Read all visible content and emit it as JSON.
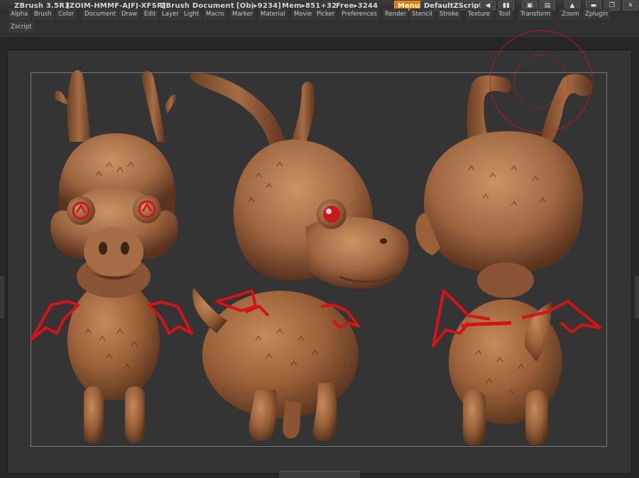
{
  "titlebar": {
    "app": "ZBrush 3.5R3",
    "serial": "[ZOIM-HMMF-AJFJ-XFSR]",
    "document": "ZBrush Document",
    "obj": "[Obj▸9234]",
    "mem": "Mem▸851+32",
    "free": "Free▸3244",
    "menus_label": "Menus",
    "script_label": "DefaultZScript"
  },
  "menubar": {
    "items": [
      "Alpha",
      "Brush",
      "Color",
      "Document",
      "Draw",
      "Edit",
      "Layer",
      "Light",
      "Macro",
      "Marker",
      "Material",
      "Movie",
      "Picker",
      "Preferences",
      "Render",
      "Stencil",
      "Stroke",
      "Texture",
      "Tool",
      "Transform",
      "Zoom",
      "Zplugin",
      "Zscript"
    ]
  },
  "colors": {
    "accent": "#e07a00",
    "clay": "#a0653f",
    "clay_dark": "#5e3620",
    "marker_red": "#d41414"
  },
  "icons": {
    "window_controls": [
      "help-icon",
      "minimize-icon",
      "restore-icon",
      "close-icon"
    ]
  }
}
